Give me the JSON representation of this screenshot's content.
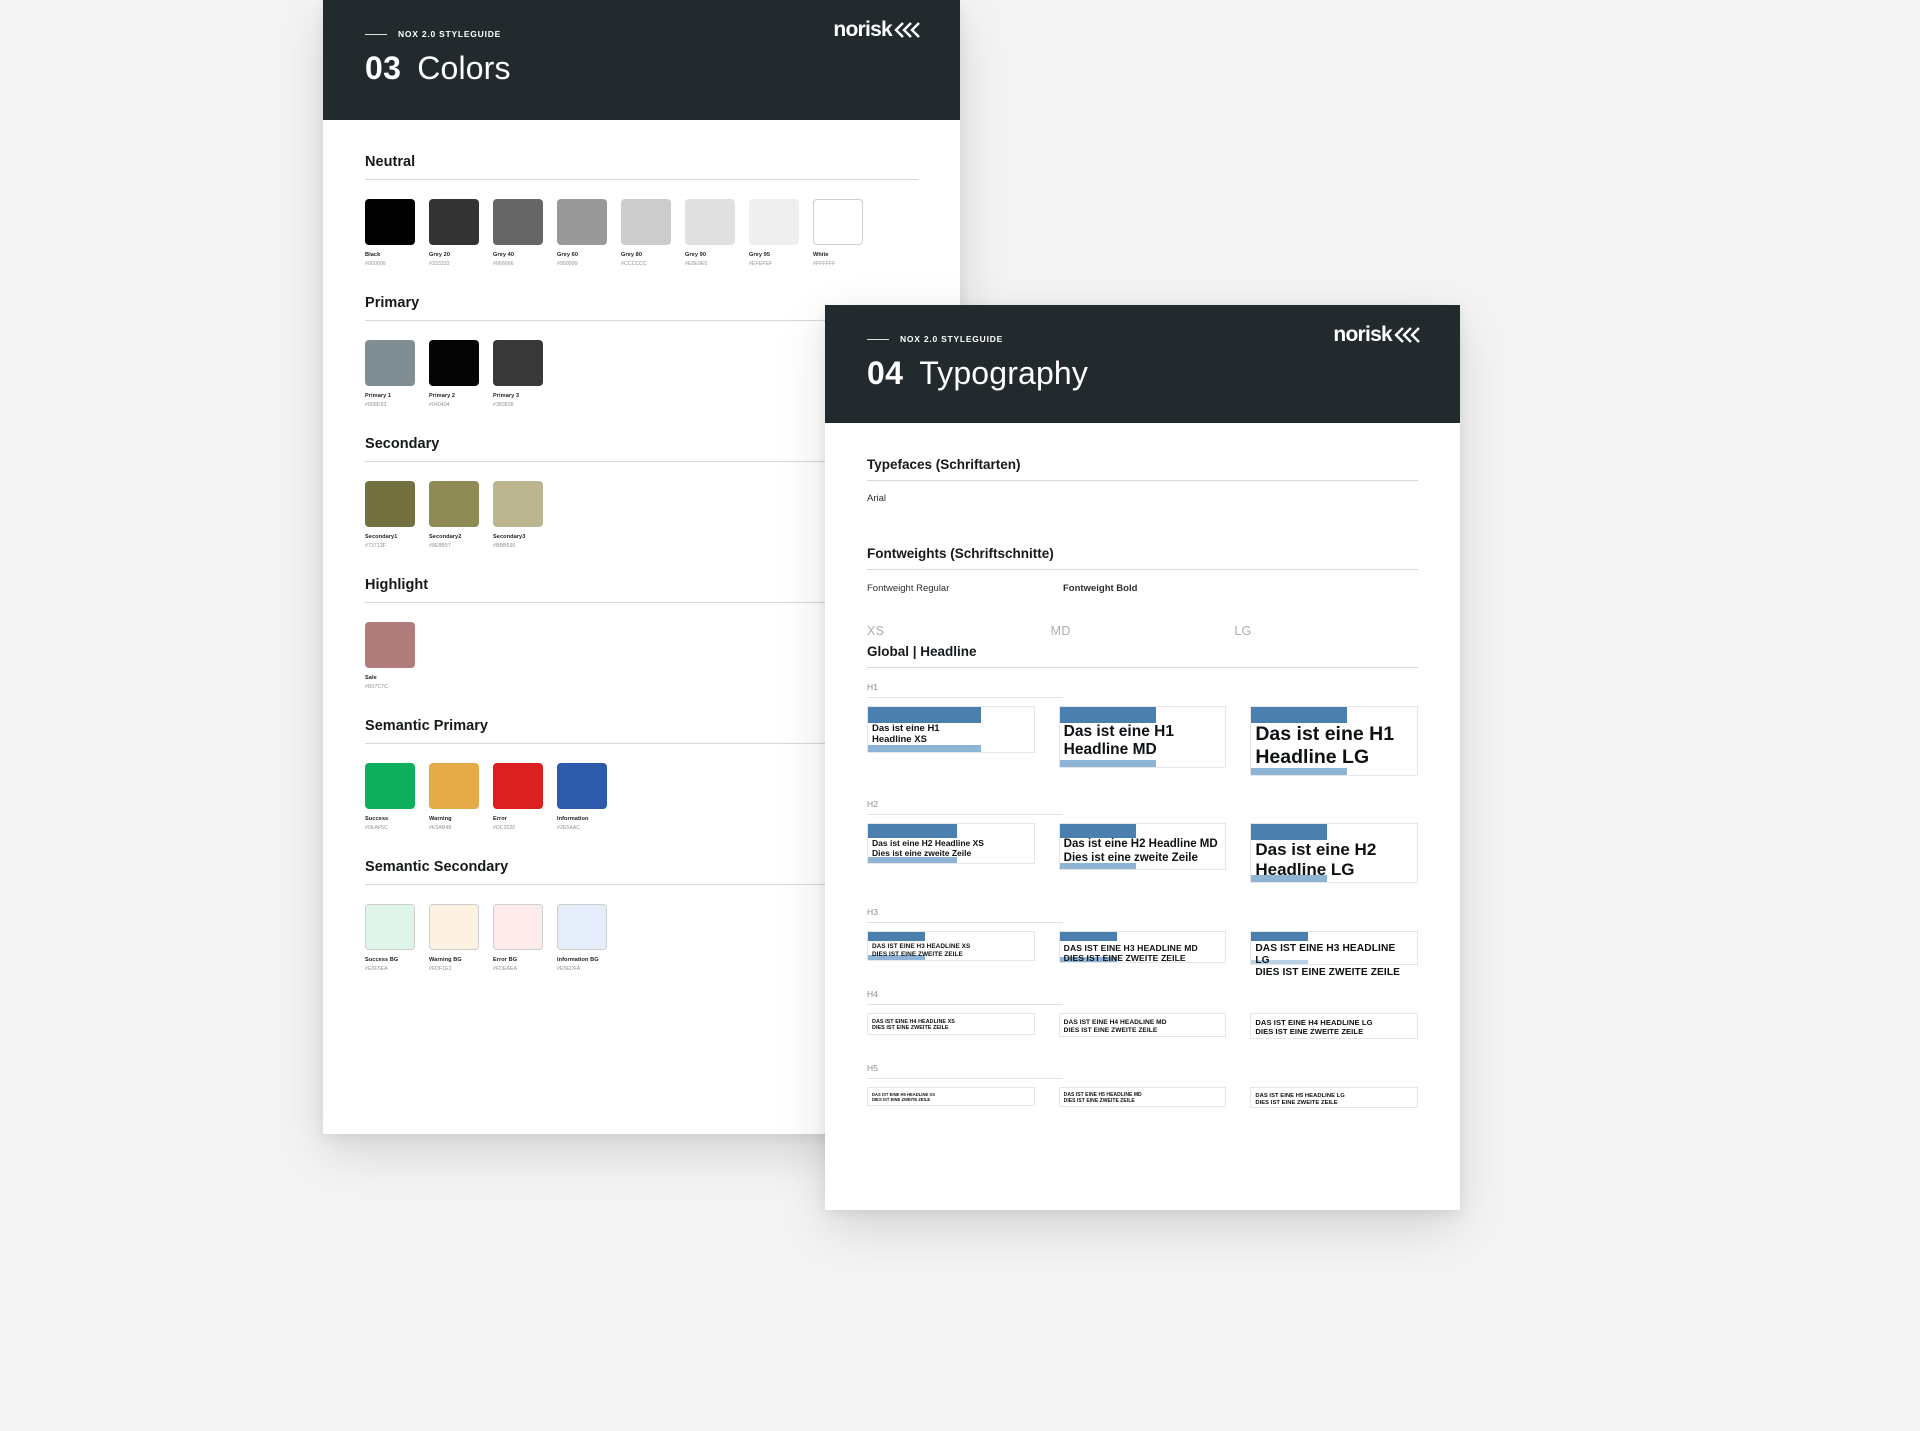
{
  "brand": {
    "wordmark": "norisk",
    "eyebrow": "NOX 2.0 STYLEGUIDE"
  },
  "colors_card": {
    "number": "03",
    "title": "Colors",
    "sections": [
      {
        "title": "Neutral",
        "swatches": [
          {
            "name": "Black",
            "hex": "#000000"
          },
          {
            "name": "Grey 20",
            "hex": "#333333"
          },
          {
            "name": "Grey 40",
            "hex": "#666666"
          },
          {
            "name": "Grey 60",
            "hex": "#999999"
          },
          {
            "name": "Grey 80",
            "hex": "#CCCCCC"
          },
          {
            "name": "Grey 90",
            "hex": "#E0E0E0"
          },
          {
            "name": "Grey 95",
            "hex": "#EFEFEF"
          },
          {
            "name": "White",
            "hex": "#FFFFFF"
          }
        ]
      },
      {
        "title": "Primary",
        "swatches": [
          {
            "name": "Primary 1",
            "hex": "#808D93"
          },
          {
            "name": "Primary 2",
            "hex": "#040404"
          },
          {
            "name": "Primary 3",
            "hex": "#383838"
          }
        ]
      },
      {
        "title": "Secondary",
        "swatches": [
          {
            "name": "Secondary1",
            "hex": "#73713F"
          },
          {
            "name": "Secondary2",
            "hex": "#8E8B57"
          },
          {
            "name": "Secondary3",
            "hex": "#BBB690"
          }
        ]
      },
      {
        "title": "Highlight",
        "swatches": [
          {
            "name": "Sale",
            "hex": "#B07C7C"
          }
        ]
      },
      {
        "title": "Semantic Primary",
        "swatches": [
          {
            "name": "Success",
            "hex": "#0EAF5C"
          },
          {
            "name": "Warning",
            "hex": "#E5AB48"
          },
          {
            "name": "Error",
            "hex": "#DC2020"
          },
          {
            "name": "Information",
            "hex": "#2E5AAC"
          }
        ]
      },
      {
        "title": "Semantic Secondary",
        "swatches": [
          {
            "name": "Success BG",
            "hex": "#E0F5EA"
          },
          {
            "name": "Warning BG",
            "hex": "#FDF1E2"
          },
          {
            "name": "Error BG",
            "hex": "#FDEAEA"
          },
          {
            "name": "Information BG",
            "hex": "#E5EDFA"
          }
        ]
      }
    ]
  },
  "typography_card": {
    "number": "04",
    "title": "Typography",
    "typefaces": {
      "heading": "Typefaces (Schriftarten)",
      "value": "Arial"
    },
    "fontweights": {
      "heading": "Fontweights (Schriftschnitte)",
      "regular": "Fontweight Regular",
      "bold": "Fontweight Bold"
    },
    "sizes": {
      "xs": "XS",
      "md": "MD",
      "lg": "LG"
    },
    "global_headline": {
      "heading": "Global | Headline",
      "rows": [
        {
          "tag": "H1",
          "xs": "Das ist eine H1\nHeadline XS",
          "md": "Das ist eine H1\nHeadline MD",
          "lg": "Das ist eine H1\nHeadline LG"
        },
        {
          "tag": "H2",
          "xs": "Das ist eine H2 Headline XS\nDies ist eine zweite Zeile",
          "md": "Das ist eine H2 Headline MD\nDies ist eine zweite Zeile",
          "lg": "Das ist eine H2\nHeadline LG"
        },
        {
          "tag": "H3",
          "xs": "DAS IST EINE H3 HEADLINE XS\nDIES IST EINE ZWEITE ZEILE",
          "md": "DAS IST EINE H3 HEADLINE MD\nDIES IST EINE ZWEITE ZEILE",
          "lg": "DAS IST EINE H3 HEADLINE LG\nDIES IST EINE ZWEITE ZEILE"
        },
        {
          "tag": "H4",
          "xs": "DAS IST EINE H4 HEADLINE XS\nDIES IST EINE ZWEITE ZEILE",
          "md": "DAS IST EINE H4 HEADLINE MD\nDIES IST EINE ZWEITE ZEILE",
          "lg": "DAS IST EINE H4 HEADLINE LG\nDIES IST EINE ZWEITE ZEILE"
        },
        {
          "tag": "H5",
          "xs": "DAS IST EINE H5 HEADLINE XS\nDIES IST EINE ZWEITE ZEILE",
          "md": "DAS IST EINE H5 HEADLINE MD\nDIES IST EINE ZWEITE ZEILE",
          "lg": "DAS IST EINE H5 HEADLINE LG\nDIES IST EINE ZWEITE ZEILE"
        }
      ]
    }
  },
  "theme": {
    "header_bg": "#222a2e",
    "accent_bar": "#4a7fae",
    "accent_bar_light": "#8db4d4",
    "page_bg": "#f4f4f4"
  }
}
